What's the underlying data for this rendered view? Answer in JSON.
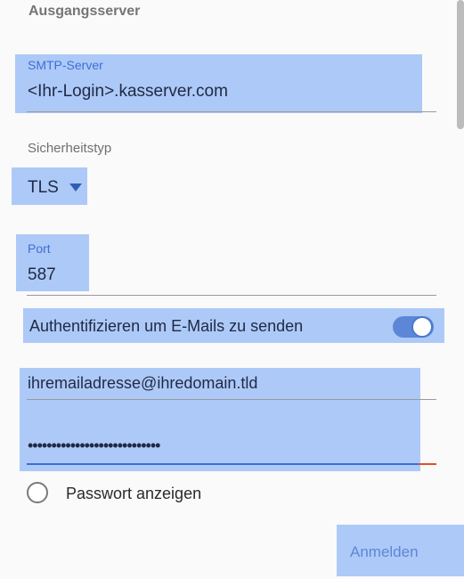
{
  "section": {
    "title": "Ausgangsserver"
  },
  "smtp": {
    "label": "SMTP-Server",
    "value": "<Ihr-Login>.kasserver.com"
  },
  "security": {
    "label": "Sicherheitstyp",
    "value": "TLS"
  },
  "port": {
    "label": "Port",
    "value": "587"
  },
  "auth": {
    "label": "Authentifizieren um E-Mails zu senden",
    "enabled": true
  },
  "credentials": {
    "email": "ihremailadresse@ihredomain.tld",
    "password": "••••••••••••••••••••••••••••"
  },
  "show_password": {
    "label": "Passwort anzeigen",
    "checked": false
  },
  "login_button": {
    "label": "Anmelden"
  },
  "colors": {
    "highlight": "#a9c6f7",
    "accent": "#3d6fd4",
    "toggle": "#5b87d6",
    "error_line": "#e0502a"
  },
  "icons": {
    "dropdown": "triangle-down-icon",
    "toggle": "toggle-switch-icon",
    "radio": "radio-button-icon"
  }
}
